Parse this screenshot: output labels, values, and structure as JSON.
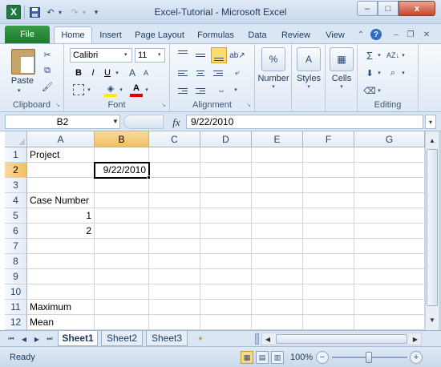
{
  "window": {
    "title": "Excel-Tutorial - Microsoft Excel",
    "app_icon": "excel-logo",
    "buttons": {
      "minimize": "–",
      "maximize": "□",
      "close": "x"
    }
  },
  "qat": {
    "save_icon": "save-icon",
    "undo_icon": "undo-icon",
    "redo_icon": "redo-icon",
    "customize_icon": "customize-qat-icon"
  },
  "ribbon_tabs": [
    "File",
    "Home",
    "Insert",
    "Page Layout",
    "Formulas",
    "Data",
    "Review",
    "View"
  ],
  "active_ribbon_tab": "Home",
  "ribbon": {
    "clipboard": {
      "label": "Clipboard",
      "paste_label": "Paste"
    },
    "font": {
      "label": "Font",
      "font_name": "Calibri",
      "font_size": "11",
      "bold": "B",
      "italic": "I",
      "underline": "U",
      "fill_color": "#ffea00",
      "font_color": "#e00000"
    },
    "alignment": {
      "label": "Alignment",
      "active_button": "align-bottom"
    },
    "number": {
      "label": "Number",
      "icon_glyph": "%"
    },
    "styles": {
      "label": "Styles"
    },
    "cells": {
      "label": "Cells"
    },
    "editing": {
      "label": "Editing",
      "autosum_glyph": "Σ"
    }
  },
  "formula_bar": {
    "name_box": "B2",
    "fx_label": "fx",
    "formula": "9/22/2010"
  },
  "grid": {
    "columns": [
      "A",
      "B",
      "C",
      "D",
      "E",
      "F",
      "G"
    ],
    "selected_column": "B",
    "rows": [
      "1",
      "2",
      "3",
      "4",
      "5",
      "6",
      "7",
      "8",
      "9",
      "10",
      "11",
      "12"
    ],
    "selected_row": "2",
    "active_cell": "B2",
    "cells": {
      "A1": "Project",
      "B2": "9/22/2010",
      "A4": "Case Number",
      "A5": "1",
      "A6": "2",
      "A11": "Maximum",
      "A12": "Mean"
    },
    "right_aligned": [
      "A5",
      "A6",
      "B2"
    ]
  },
  "sheets": {
    "tabs": [
      "Sheet1",
      "Sheet2",
      "Sheet3"
    ],
    "active": "Sheet1"
  },
  "status_bar": {
    "status": "Ready",
    "zoom": "100%",
    "zoom_percent": 100
  },
  "colors": {
    "ribbon_background": "#dfe9f5",
    "file_tab": "#2a8a3a",
    "selected_header": "#f1c15f",
    "active_align_button": "#fbdb72"
  }
}
